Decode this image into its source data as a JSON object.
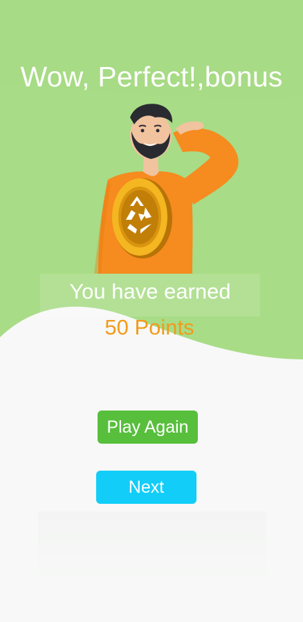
{
  "screen": {
    "title": "Wow, Perfect!,bonus",
    "earned_text": "You have earned",
    "points_text": "50 Points"
  },
  "buttons": {
    "play_again": "Play Again",
    "next": "Next"
  },
  "illustration": {
    "character_icon": "smiling-man-salute-icon",
    "coin_icon": "recycle-coin-icon"
  },
  "colors": {
    "background_green": "#a8dc86",
    "background_white": "#f7f8f7",
    "points_orange": "#f39a1a",
    "play_again_green": "#57bf3c",
    "next_cyan": "#12cdf8",
    "shirt_orange": "#f68b1f",
    "coin_gold": "#d99410"
  }
}
